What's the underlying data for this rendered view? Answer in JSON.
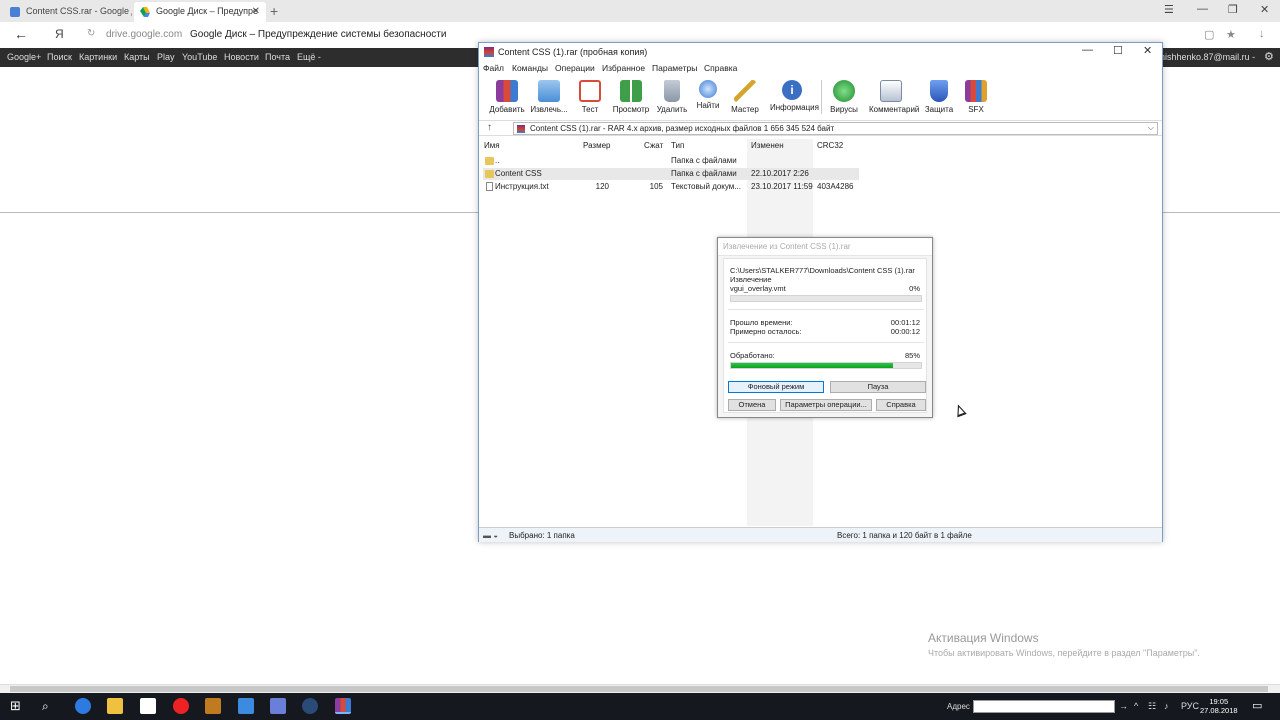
{
  "browser": {
    "tabs": [
      {
        "label": "Content CSS.rar - Google Д",
        "active": false
      },
      {
        "label": "Google Диск – Предупре",
        "active": true
      }
    ],
    "new_tab": "+",
    "nav_back": "←",
    "yandex_logo": "Я",
    "reload": "↻",
    "domain": "drive.google.com",
    "page_title": "Google Диск – Предупреждение системы безопасности"
  },
  "google_bar": {
    "items": [
      "Google+",
      "Поиск",
      "Картинки",
      "Карты",
      "Play",
      "YouTube",
      "Новости",
      "Почта",
      "Ещё -"
    ],
    "user": "nishhenko.87@mail.ru -"
  },
  "winrar": {
    "title": "Content CSS (1).rar (пробная копия)",
    "menu": [
      "Файл",
      "Команды",
      "Операции",
      "Избранное",
      "Параметры",
      "Справка"
    ],
    "toolbar": [
      {
        "label": "Добавить",
        "icon": "add-books-icon",
        "color": "#8c3c9c"
      },
      {
        "label": "Извлечь...",
        "icon": "extract-folder-icon",
        "color": "#4a8fd6"
      },
      {
        "label": "Тест",
        "icon": "test-checklist-icon",
        "color": "#d94a3a"
      },
      {
        "label": "Просмотр",
        "icon": "view-book-icon",
        "color": "#3e9e4a"
      },
      {
        "label": "Удалить",
        "icon": "delete-trash-icon",
        "color": "#8a96a6"
      },
      {
        "label": "Найти",
        "icon": "find-magnifier-icon",
        "color": "#3b7bd1"
      },
      {
        "label": "Мастер",
        "icon": "wizard-wand-icon",
        "color": "#d6a42a"
      },
      {
        "label": "Информация",
        "icon": "info-icon",
        "color": "#3a6fc4"
      },
      {
        "label": "Вирусы",
        "icon": "virus-scan-icon",
        "color": "#2aa43a"
      },
      {
        "label": "Комментарий",
        "icon": "comment-icon",
        "color": "#7a8aa0"
      },
      {
        "label": "Защита",
        "icon": "shield-icon",
        "color": "#3a6fd4"
      },
      {
        "label": "SFX",
        "icon": "sfx-icon",
        "color": "#e0a030"
      }
    ],
    "path": "Content CSS (1).rar - RAR 4.x архив, размер исходных файлов 1 656 345 524 байт",
    "columns": {
      "name": "Имя",
      "size": "Размер",
      "packed": "Сжат",
      "type": "Тип",
      "modified": "Изменен",
      "crc": "CRC32"
    },
    "rows": [
      {
        "name": "..",
        "size": "",
        "packed": "",
        "type": "Папка с файлами",
        "modified": "",
        "crc": "",
        "kind": "folder"
      },
      {
        "name": "Content CSS",
        "size": "",
        "packed": "",
        "type": "Папка с файлами",
        "modified": "22.10.2017 2:26",
        "crc": "",
        "kind": "folder"
      },
      {
        "name": "Инструкция.txt",
        "size": "120",
        "packed": "105",
        "type": "Текстовый докум...",
        "modified": "23.10.2017 11:59",
        "crc": "403A4286",
        "kind": "text"
      }
    ],
    "status_left": "Выбрано: 1 папка",
    "status_right": "Всего: 1 папка и 120 байт в 1 файле"
  },
  "extract_dialog": {
    "title": "Извлечение из Content CSS (1).rar",
    "path": "C:\\Users\\STALKER777\\Downloads\\Content CSS (1).rar",
    "action": "Извлечение",
    "file": "vgui_overlay.vmt",
    "file_percent": "0%",
    "file_progress": 0,
    "elapsed_label": "Прошло времени:",
    "elapsed": "00:01:12",
    "remaining_label": "Примерно осталось:",
    "remaining": "00:00:12",
    "processed_label": "Обработано:",
    "processed_percent": "85%",
    "processed_progress": 0.85,
    "buttons": {
      "background": "Фоновый режим",
      "pause": "Пауза",
      "cancel": "Отмена",
      "options": "Параметры операции...",
      "help": "Справка"
    }
  },
  "activation": {
    "title": "Активация Windows",
    "text": "Чтобы активировать Windows, перейдите в раздел \"Параметры\"."
  },
  "taskbar": {
    "address_label": "Адрес",
    "language": "РУС",
    "time": "19:05",
    "date": "27.08.2018"
  }
}
